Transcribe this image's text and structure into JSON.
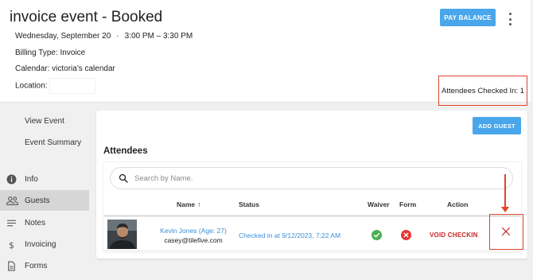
{
  "event": {
    "title": "invoice event - Booked",
    "date": "Wednesday, September 20",
    "separator": "·",
    "time": "3:00 PM – 3:30 PM",
    "billing_type": "Billing Type: Invoice",
    "calendar": "Calendar: victoria's calendar",
    "location_label": "Location:",
    "pay_balance_label": "PAY BALANCE",
    "checked_in_text": "Attendees Checked In: 1"
  },
  "sidebar": {
    "items": [
      {
        "label": "View Event",
        "icon": "none"
      },
      {
        "label": "Event Summary",
        "icon": "none"
      },
      {
        "label": "Info",
        "icon": "info-icon"
      },
      {
        "label": "Guests",
        "icon": "people-icon",
        "active": true
      },
      {
        "label": "Notes",
        "icon": "notes-icon"
      },
      {
        "label": "Invoicing",
        "icon": "dollar-icon"
      },
      {
        "label": "Forms",
        "icon": "document-icon"
      }
    ]
  },
  "attendees": {
    "add_guest_label": "ADD GUEST",
    "title": "Attendees",
    "search_placeholder": "Search by Name.",
    "columns": {
      "name": "Name",
      "sort_indicator": "↑",
      "status": "Status",
      "waiver": "Waiver",
      "form": "Form",
      "action": "Action"
    },
    "rows": [
      {
        "name": "Kevin Jones (Age: 27)",
        "email": "casey@tilefive.com",
        "status": "Checked in at 9/12/2023, 7:22 AM",
        "waiver": "complete",
        "form": "incomplete",
        "action_label": "VOID CHECKIN",
        "remove_label": "✕"
      }
    ]
  },
  "colors": {
    "accent_blue": "#4aa6ea",
    "link_blue": "#3b8fd8",
    "void_red": "#c62828",
    "annotation_red": "#e0432d",
    "success_green": "#4caf50",
    "error_red": "#e53935"
  }
}
